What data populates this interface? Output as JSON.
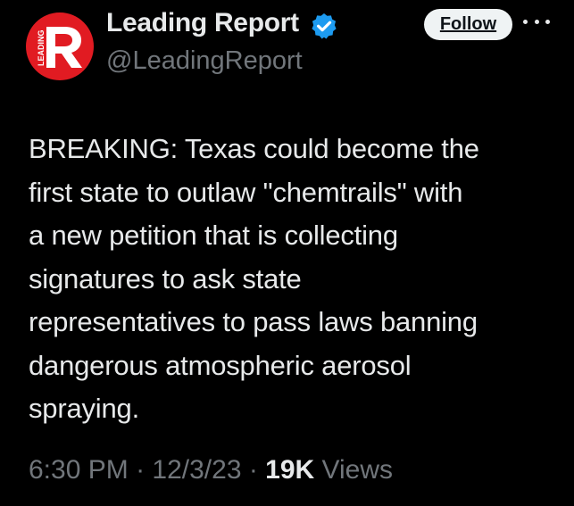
{
  "author": {
    "display_name": "Leading Report",
    "handle": "@LeadingReport",
    "avatar_letter": "R",
    "avatar_side_text": "LEADING",
    "avatar_color": "#e11b22",
    "verified_icon": "verified-badge-icon",
    "verified_color": "#1d9bf0"
  },
  "actions": {
    "follow_label": "Follow",
    "more_icon": "more-options-icon"
  },
  "tweet": {
    "text_lines": [
      "BREAKING: Texas could become the",
      "first state to outlaw \"chemtrails\" with",
      "a new petition that is collecting",
      "signatures to ask state",
      "representatives to pass laws banning",
      "dangerous atmospheric aerosol",
      "spraying."
    ]
  },
  "meta": {
    "time": "6:30 PM",
    "separator": " · ",
    "date": "12/3/23",
    "views_count": "19K",
    "views_label": " Views"
  }
}
